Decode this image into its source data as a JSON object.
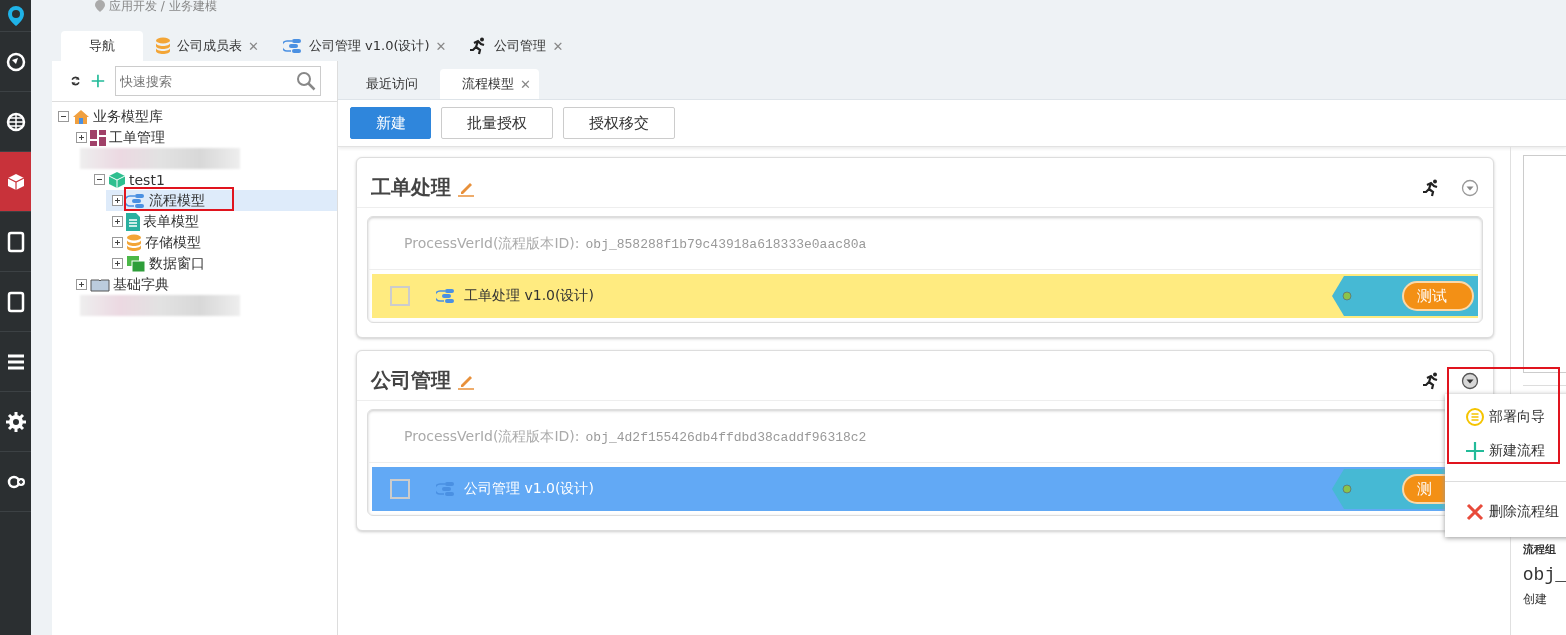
{
  "breadcrumb": "应用开发 / 业务建模",
  "rail": [
    {
      "selected": false
    },
    {
      "selected": false
    },
    {
      "selected": false
    },
    {
      "selected": true
    },
    {
      "selected": false
    },
    {
      "selected": false
    },
    {
      "selected": false
    },
    {
      "selected": false
    },
    {
      "selected": false
    }
  ],
  "tabs": [
    {
      "label": "导航",
      "selected": true
    },
    {
      "label": "公司成员表",
      "close": "✕",
      "selected": false
    },
    {
      "label": "公司管理 v1.0(设计)",
      "close": "✕",
      "selected": false
    },
    {
      "label": "公司管理",
      "close": "✕",
      "selected": false
    }
  ],
  "nav": {
    "search": {
      "placeholder": "快速搜索"
    },
    "tree": [
      {
        "kind": "node",
        "label": "业务模型库",
        "expanded": true,
        "selected": false,
        "children": [
          {
            "kind": "node",
            "label": "工单管理",
            "expanded": false,
            "selected": false
          },
          {
            "kind": "redacted",
            "children": [
              {
                "kind": "node",
                "label": "test1",
                "expanded": true,
                "selected": false,
                "children": [
                  {
                    "kind": "node",
                    "label": "流程模型",
                    "expanded": false,
                    "selected": true,
                    "highlight_box": true
                  },
                  {
                    "kind": "node",
                    "label": "表单模型",
                    "expanded": false,
                    "selected": false
                  },
                  {
                    "kind": "node",
                    "label": "存储模型",
                    "expanded": false,
                    "selected": false
                  },
                  {
                    "kind": "node",
                    "label": "数据窗口",
                    "expanded": false,
                    "selected": false
                  }
                ]
              }
            ]
          },
          {
            "kind": "node",
            "label": "基础字典",
            "expanded": false,
            "selected": false
          },
          {
            "kind": "redacted"
          }
        ]
      }
    ]
  },
  "subtabs": [
    {
      "label": "最近访问",
      "selected": false
    },
    {
      "label": "流程模型",
      "close": "✕",
      "selected": true
    }
  ],
  "toolbar": [
    {
      "label": "新建",
      "primary": true
    },
    {
      "label": "批量授权",
      "primary": false
    },
    {
      "label": "授权移交",
      "primary": false
    }
  ],
  "groups": [
    {
      "title": "工单处理",
      "id_label": "ProcessVerId(流程版本ID):",
      "id_value": "obj_858288f1b79c43918a618333e0aac80a",
      "row": {
        "name": "工单处理 v1.0(设计)",
        "color": "#ffeb80",
        "checked": false,
        "button": "测试"
      },
      "menu_open": false
    },
    {
      "title": "公司管理",
      "id_label": "ProcessVerId(流程版本ID):",
      "id_value": "obj_4d2f155426db4ffdbd38caddf96318c2",
      "row": {
        "name": "公司管理 v1.0(设计)",
        "color": "#62a9f5",
        "checked": false,
        "button": "测"
      },
      "menu_open": true
    }
  ],
  "menu": {
    "highlight_box": true,
    "items": [
      {
        "kind": "item",
        "label": "部署向导"
      },
      {
        "kind": "item",
        "label": "新建流程"
      },
      {
        "kind": "separator"
      },
      {
        "kind": "item",
        "label": "删除流程组"
      }
    ]
  },
  "side_panel": {
    "label": "流程组",
    "value": "obj_",
    "note": "创建"
  }
}
